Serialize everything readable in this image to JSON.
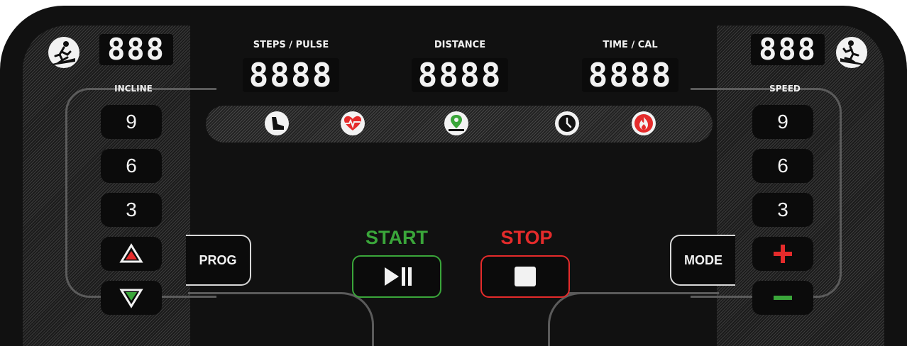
{
  "incline": {
    "display": "888",
    "label": "INCLINE",
    "presets": [
      "9",
      "6",
      "3"
    ],
    "up_icon": "triangle-up-icon",
    "down_icon": "triangle-down-icon"
  },
  "speed": {
    "display": "888",
    "label": "SPEED",
    "presets": [
      "9",
      "6",
      "3"
    ],
    "plus_icon": "plus-icon",
    "minus_icon": "minus-icon"
  },
  "displays": {
    "steps_pulse": {
      "label": "STEPS ∕ PULSE",
      "value": "8888"
    },
    "distance": {
      "label": "DISTANCE",
      "value": "8888"
    },
    "time_cal": {
      "label": "TIME ∕ CAL",
      "value": "8888"
    }
  },
  "status_icons": [
    "footprint-icon",
    "heart-pulse-icon",
    "location-pin-icon",
    "clock-icon",
    "flame-icon"
  ],
  "buttons": {
    "prog": "PROG",
    "mode": "MODE",
    "start": "START",
    "stop": "STOP"
  },
  "colors": {
    "start": "#3aa63a",
    "stop": "#e52b2b",
    "display_text": "#f2f2f2",
    "background": "#111111"
  }
}
